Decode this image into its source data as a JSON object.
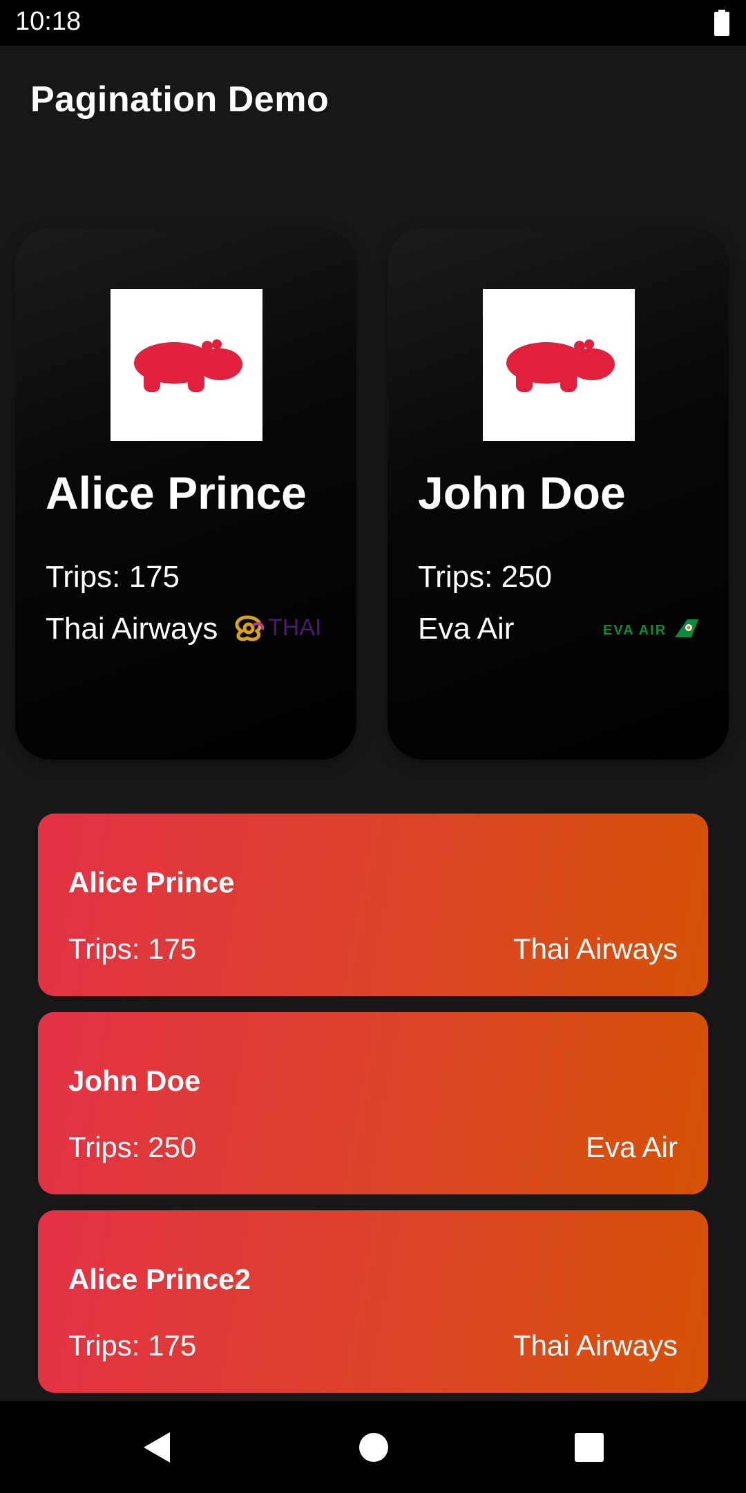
{
  "status_bar": {
    "time": "10:18"
  },
  "app_bar": {
    "title": "Pagination Demo"
  },
  "carousel": [
    {
      "name": "Alice Prince",
      "trips": "Trips: 175",
      "airline": "Thai Airways",
      "logo_text": "THAI",
      "avatar_icon": "hippo-icon"
    },
    {
      "name": "John Doe",
      "trips": "Trips: 250",
      "airline": "Eva Air",
      "logo_text": "EVA AIR",
      "avatar_icon": "hippo-icon"
    }
  ],
  "list": [
    {
      "name": "Alice Prince",
      "trips": "Trips: 175",
      "airline": "Thai Airways"
    },
    {
      "name": "John Doe",
      "trips": "Trips: 250",
      "airline": "Eva Air"
    },
    {
      "name": "Alice Prince2",
      "trips": "Trips: 175",
      "airline": "Thai Airways"
    }
  ],
  "nav": {
    "icons": [
      "back-icon",
      "home-icon",
      "recents-icon"
    ]
  },
  "colors": {
    "background": "#171717",
    "card_gradient_start": "#e33146",
    "card_gradient_end": "#d55206",
    "hippo": "#e0203c",
    "thai_purple": "#4b1a6b",
    "thai_gold": "#d9a21b",
    "eva_green": "#0c8a3c"
  }
}
